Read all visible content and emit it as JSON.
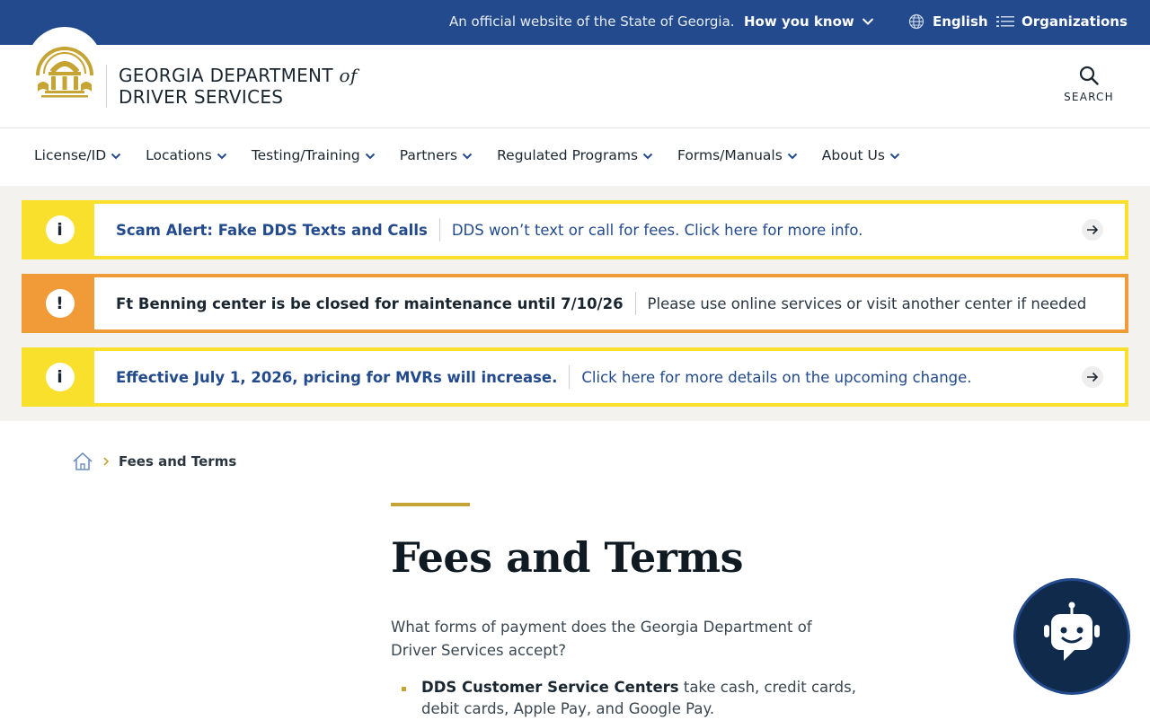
{
  "topbar": {
    "official_text": "An official website of the State of Georgia.",
    "how_you_know": "How you know",
    "language": "English",
    "organizations": "Organizations"
  },
  "header": {
    "brand_line1": "GEORGIA DEPARTMENT",
    "brand_of": "of",
    "brand_line2": "DRIVER SERVICES",
    "search_label": "SEARCH"
  },
  "nav": {
    "items": [
      {
        "label": "License/ID"
      },
      {
        "label": "Locations"
      },
      {
        "label": "Testing/Training"
      },
      {
        "label": "Partners"
      },
      {
        "label": "Regulated Programs"
      },
      {
        "label": "Forms/Manuals"
      },
      {
        "label": "About Us"
      }
    ]
  },
  "alerts": [
    {
      "type": "info",
      "color": "#f8e02c",
      "title": "Scam Alert: Fake DDS Texts and Calls",
      "message": "DDS won’t text or call for fees. Click here for more info.",
      "has_link": true
    },
    {
      "type": "warning",
      "color": "#f09a38",
      "title": "Ft Benning center is be closed for maintenance until 7/10/26",
      "message": "Please use online services or visit another center if needed",
      "has_link": false
    },
    {
      "type": "info",
      "color": "#f8e02c",
      "title": "Effective July 1, 2026, pricing for MVRs will increase.",
      "message": "Click here for more details on the upcoming change.",
      "has_link": true
    }
  ],
  "breadcrumb": {
    "current": "Fees and Terms"
  },
  "main": {
    "title": "Fees and Terms",
    "intro": "What forms of payment does the Georgia Department of Driver Services accept?",
    "bullets": [
      {
        "bold": "DDS Customer Service Centers",
        "text": " take cash, credit cards, debit cards, Apple Pay, and Google Pay."
      }
    ]
  },
  "colors": {
    "topbar": "#234a8c",
    "accent_gold": "#c6a434",
    "alert_yellow": "#f8e02c",
    "alert_orange": "#f09a38",
    "link_blue": "#234a8c",
    "chatbot": "#0f2a4a"
  },
  "icons": {
    "home": "home-icon",
    "search": "search-icon",
    "globe": "globe-icon",
    "list": "list-icon",
    "chatbot": "robot-icon"
  }
}
